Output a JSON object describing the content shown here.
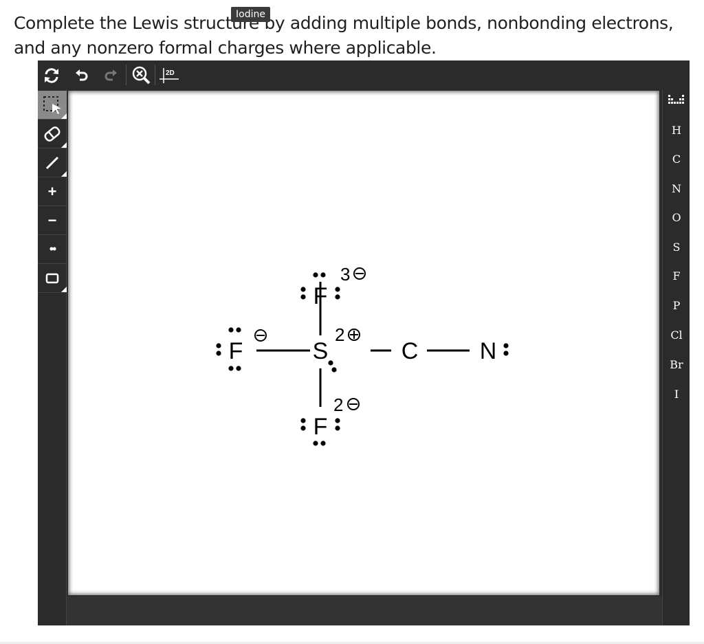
{
  "question": {
    "text": "Complete the Lewis structure by adding multiple bonds, nonbonding electrons, and any nonzero formal charges where applicable."
  },
  "tooltip": {
    "text": "Iodine"
  },
  "toolbar": {
    "buttons": [
      "refresh-icon",
      "undo-icon",
      "redo-icon",
      "zoom-reset-icon",
      "2d-clean-icon"
    ],
    "clean_label": "2D"
  },
  "left_tools": {
    "items": [
      {
        "name": "select",
        "icon": "select-marquee-icon"
      },
      {
        "name": "erase",
        "icon": "eraser-icon"
      },
      {
        "name": "bond",
        "icon": "single-bond-icon"
      },
      {
        "name": "plus",
        "label": "+"
      },
      {
        "name": "minus",
        "label": "−"
      },
      {
        "name": "lone-pair",
        "label": "••"
      },
      {
        "name": "box",
        "icon": "rectangle-icon"
      }
    ]
  },
  "elements": [
    "H",
    "C",
    "N",
    "O",
    "S",
    "F",
    "P",
    "Cl",
    "Br",
    "I"
  ],
  "periodic_table_icon": "periodic-table-icon",
  "molecule": {
    "atoms": {
      "top_f": "F",
      "left_f": "F",
      "center_s": "S",
      "bottom_f": "F",
      "carbon": "C",
      "nitrogen": "N"
    },
    "charges": {
      "top_f": "3",
      "left_f": "",
      "center_s": "2",
      "bottom_f": "2"
    }
  },
  "colors": {
    "toolbar_bg": "#2b2b2b",
    "active_tool": "#8a8a8a",
    "canvas": "#ffffff"
  }
}
